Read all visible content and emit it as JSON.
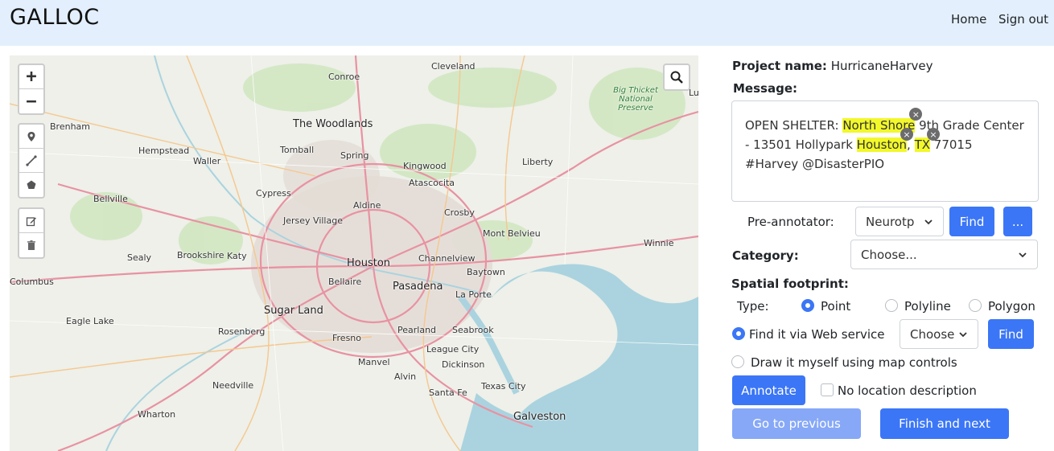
{
  "navbar": {
    "brand": "GALLOC",
    "home": "Home",
    "sign_out": "Sign out"
  },
  "map": {
    "labels": {
      "conroe": "Conroe",
      "cleveland": "Cleveland",
      "brenham": "Brenham",
      "woodlands": "The Woodlands",
      "hempstead": "Hempstead",
      "tomball": "Tomball",
      "waller": "Waller",
      "spring": "Spring",
      "kingwood": "Kingwood",
      "liberty": "Liberty",
      "cypress": "Cypress",
      "atascocita": "Atascocita",
      "bellville": "Bellville",
      "aldine": "Aldine",
      "jersey_village": "Jersey Village",
      "crosby": "Crosby",
      "mont_belvieu": "Mont Belvieu",
      "winnie": "Winnie",
      "sealy": "Sealy",
      "brookshire": "Brookshire",
      "katy": "Katy",
      "houston": "Houston",
      "channelview": "Channelview",
      "columbus": "Columbus",
      "baytown": "Baytown",
      "bellaire": "Bellaire",
      "pasadena": "Pasadena",
      "sugar_land": "Sugar Land",
      "la_porte": "La Porte",
      "eagle_lake": "Eagle Lake",
      "rosenberg": "Rosenberg",
      "pearland": "Pearland",
      "seabrook": "Seabrook",
      "fresno": "Fresno",
      "league_city": "League City",
      "manvel": "Manvel",
      "dickinson": "Dickinson",
      "alvin": "Alvin",
      "needville": "Needville",
      "texas_city": "Texas City",
      "santa_fe": "Santa Fe",
      "wharton": "Wharton",
      "galveston": "Galveston",
      "big_thicket": "Big Thicket National Preserve",
      "edge_l": "Lu"
    },
    "icons": [
      "zoom-in-icon",
      "zoom-out-icon",
      "marker-icon",
      "polyline-icon",
      "polygon-icon",
      "edit-icon",
      "trash-icon",
      "search-icon"
    ],
    "zoom_in": "+",
    "zoom_out": "−"
  },
  "panel": {
    "project_label": "Project name:",
    "project_name": "HurricaneHarvey",
    "message_label": "Message:",
    "message": {
      "t1": "OPEN SHELTER: ",
      "h1": "North Shore",
      "t2": " 9th Grade Center - 13501 Hollypark ",
      "h2": "Houston",
      "t3": ", ",
      "h3": "TX",
      "t4": " 77015 #Harvey @DisasterPIO",
      "remove_glyph": "×"
    },
    "preannotator_label": "Pre-annotator:",
    "preannotator_value": "Neurotp",
    "find_label": "Find",
    "more_label": "...",
    "category_label": "Category:",
    "category_value": "Choose...",
    "spatial_label": "Spatial footprint:",
    "type_label": "Type:",
    "types": [
      "Point",
      "Polyline",
      "Polygon"
    ],
    "web_service_label": "Find it via Web service",
    "web_service_select": "Choose",
    "find2_label": "Find",
    "draw_label": "Draw it myself using map controls",
    "annotate_label": "Annotate",
    "no_location_label": "No location description",
    "prev_label": "Go to previous",
    "next_label": "Finish and next"
  },
  "colors": {
    "accent": "#3b76f6",
    "accent_disabled": "#86a8f7",
    "navbar_bg": "#e3effc",
    "highlight": "#f2f82a",
    "water": "#aad3df"
  }
}
